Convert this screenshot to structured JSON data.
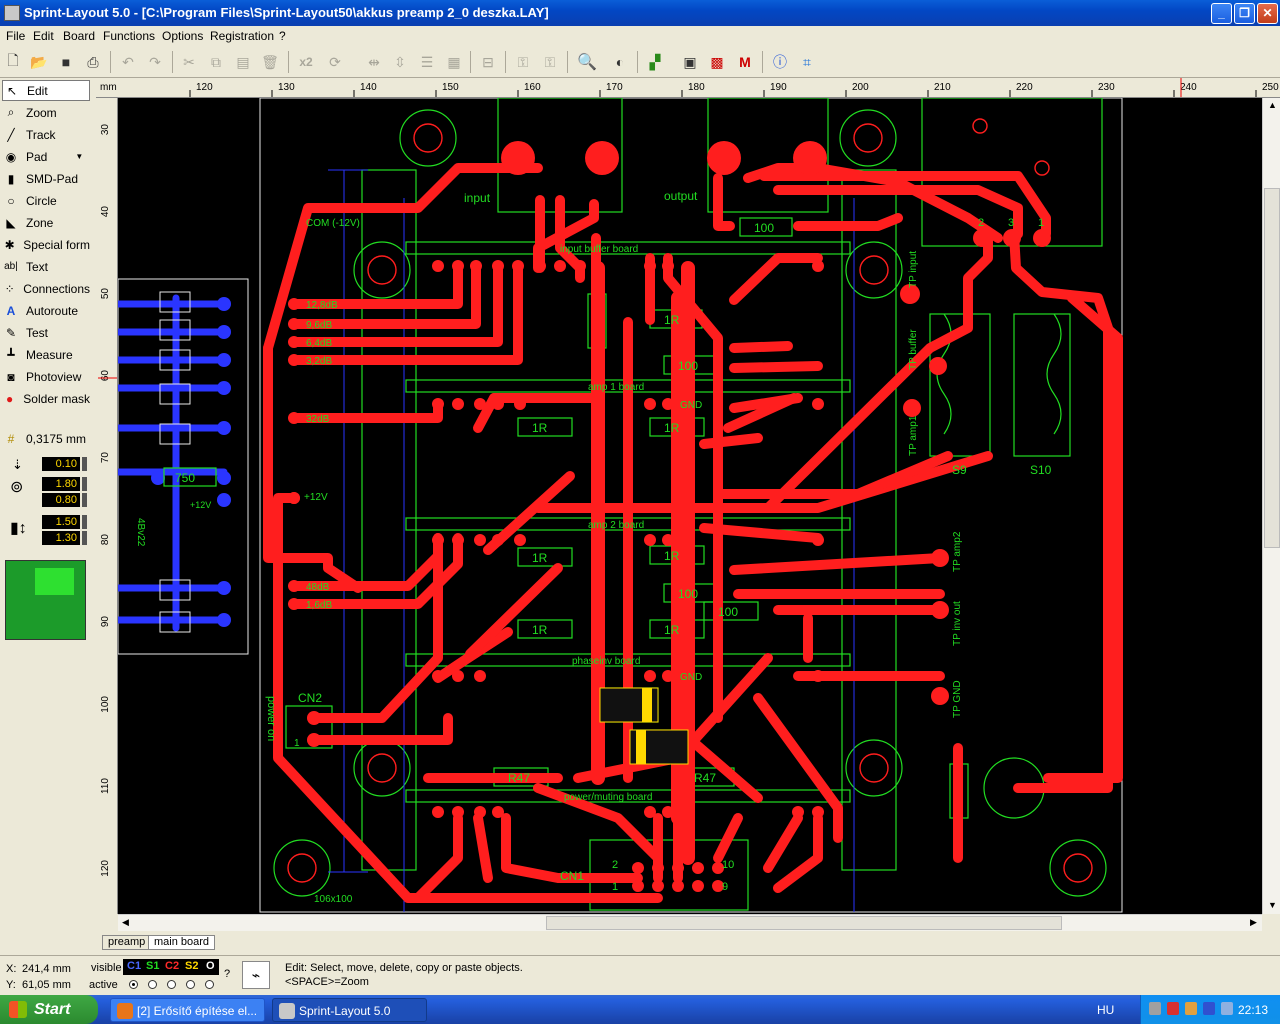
{
  "window": {
    "title": "Sprint-Layout 5.0 - [C:\\Program Files\\Sprint-Layout50\\akkus preamp 2_0 deszka.LAY]",
    "minimize_label": "_",
    "restore_label": "❐",
    "close_label": "✕"
  },
  "menu": [
    "File",
    "Edit",
    "Board",
    "Functions",
    "Options",
    "Registration",
    "?"
  ],
  "toolbar": {
    "zoom_x2_label": "x2"
  },
  "tools": [
    {
      "label": "Edit",
      "icon": "cursor-icon"
    },
    {
      "label": "Zoom",
      "icon": "magnifier-icon"
    },
    {
      "label": "Track",
      "icon": "track-icon"
    },
    {
      "label": "Pad",
      "icon": "pad-icon"
    },
    {
      "label": "SMD-Pad",
      "icon": "smd-pad-icon"
    },
    {
      "label": "Circle",
      "icon": "circle-icon"
    },
    {
      "label": "Zone",
      "icon": "zone-icon"
    },
    {
      "label": "Special form",
      "icon": "special-form-icon"
    },
    {
      "label": "Text",
      "icon": "text-icon"
    },
    {
      "label": "Connections",
      "icon": "connections-icon"
    },
    {
      "label": "Autoroute",
      "icon": "autoroute-icon"
    },
    {
      "label": "Test",
      "icon": "test-icon"
    },
    {
      "label": "Measure",
      "icon": "measure-icon"
    },
    {
      "label": "Photoview",
      "icon": "camera-icon"
    },
    {
      "label": "Solder mask",
      "icon": "solder-mask-icon"
    }
  ],
  "grid": {
    "value": "0,3175 mm"
  },
  "fields": {
    "track_width": "0.10",
    "pad_outer": "1.80",
    "pad_inner": "0.80",
    "smd_width": "1.50",
    "smd_height": "1.30"
  },
  "ruler": {
    "unit": "mm",
    "top_ticks": [
      "120",
      "130",
      "140",
      "150",
      "160",
      "170",
      "180",
      "190",
      "200",
      "210",
      "220",
      "230",
      "240",
      "250"
    ],
    "left_ticks": [
      "30",
      "40",
      "50",
      "60",
      "70",
      "80",
      "90",
      "100",
      "110",
      "120"
    ]
  },
  "pcb": {
    "labels": {
      "input": "input",
      "output": "output",
      "com": "COM (-12V)",
      "input_buffer_board": "input buffer board",
      "amp1_board": "amp 1 board",
      "amp2_board": "amp 2 board",
      "phaseinv_board": "phaseinv board",
      "power_muting_board": "power/muting board",
      "cn1": "CN1",
      "cn2": "CN2",
      "power_on": "power on",
      "size": "106x100",
      "s9": "S9",
      "s10": "S10",
      "tp_amp2": "TP amp2",
      "tp_inv_out": "TP inv out",
      "tp_gnd": "TP GND",
      "tp_buffer": "TP buffer",
      "tp_amp1": "TP amp1",
      "tp_input": "TP input",
      "level_12db": "12,8dB",
      "level_9db": "9,6dB",
      "level_6db": "6,4dB",
      "level_3db": "3,2dB",
      "level_32db": "32dB",
      "level_48db": "48dB",
      "level_16db": "1,6dB",
      "plus12v": "+12V",
      "r_100": "100",
      "r_1r": "1R",
      "r_r47": "R47",
      "r_750": "750",
      "gnd": "GND",
      "ic_label": "4Bv22",
      "pin1": "1",
      "pin2": "2",
      "pin3": "3",
      "pin9": "9",
      "pin10": "10"
    }
  },
  "tabs": [
    "preamp",
    "main board"
  ],
  "status": {
    "x_label": "X:",
    "x_value": "241,4 mm",
    "y_label": "Y:",
    "y_value": "61,05 mm",
    "visible_label": "visible",
    "active_label": "active",
    "layers": [
      "C1",
      "S1",
      "C2",
      "S2",
      "O"
    ],
    "help_mark": "?",
    "message_line1": "Edit: Select, move, delete, copy or paste objects.",
    "message_line2": "<SPACE>=Zoom"
  },
  "taskbar": {
    "start_label": "Start",
    "tasks": [
      "[2] Erősítő építése el...",
      "Sprint-Layout 5.0"
    ],
    "language": "HU",
    "clock": "22:13"
  },
  "colors": {
    "copper_top": "#ff1e1e",
    "silkscreen": "#22dd22",
    "copper_bottom": "#2a35ff",
    "canvas": "#000000"
  }
}
